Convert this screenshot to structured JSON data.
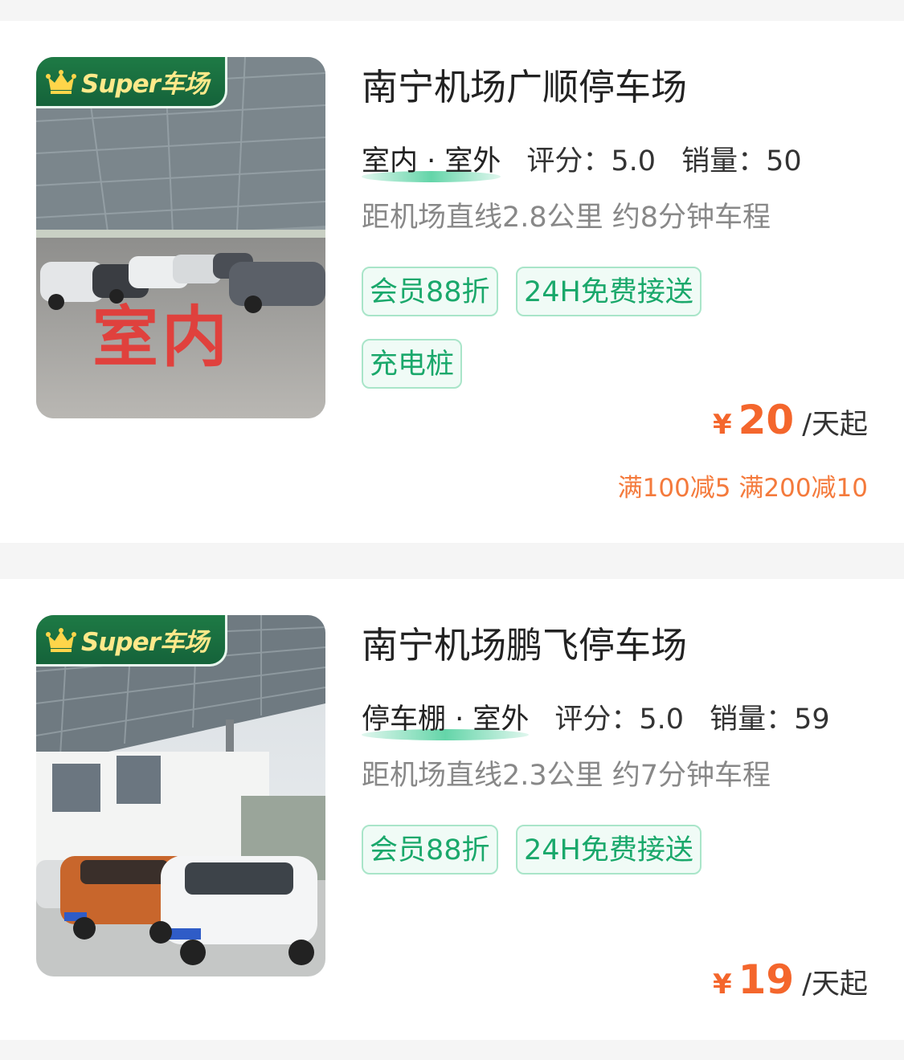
{
  "listings": [
    {
      "badge": "Super车场",
      "photo_label": "室内",
      "name": "南宁机场广顺停车场",
      "type": "室内 · 室外",
      "rating_label": "评分：5.0",
      "sales_label": "销量：50",
      "distance": "距机场直线2.8公里 约8分钟车程",
      "tags": [
        "会员88折",
        "24H免费接送",
        "充电桩"
      ],
      "currency": "¥",
      "price": "20",
      "unit": "/天起",
      "promo": "满100减5 满200减10"
    },
    {
      "badge": "Super车场",
      "name": "南宁机场鹏飞停车场",
      "type": "停车棚 · 室外",
      "rating_label": "评分：5.0",
      "sales_label": "销量：59",
      "distance": "距机场直线2.3公里 约7分钟车程",
      "tags": [
        "会员88折",
        "24H免费接送"
      ],
      "currency": "¥",
      "price": "19",
      "unit": "/天起"
    }
  ],
  "colors": {
    "accent_green": "#1aa86b",
    "tag_border": "#a9e5c9",
    "price_orange": "#f4662c",
    "badge_green": "#15633a",
    "badge_text": "#ffe98a"
  },
  "icons": {
    "crown": "crown-icon"
  }
}
